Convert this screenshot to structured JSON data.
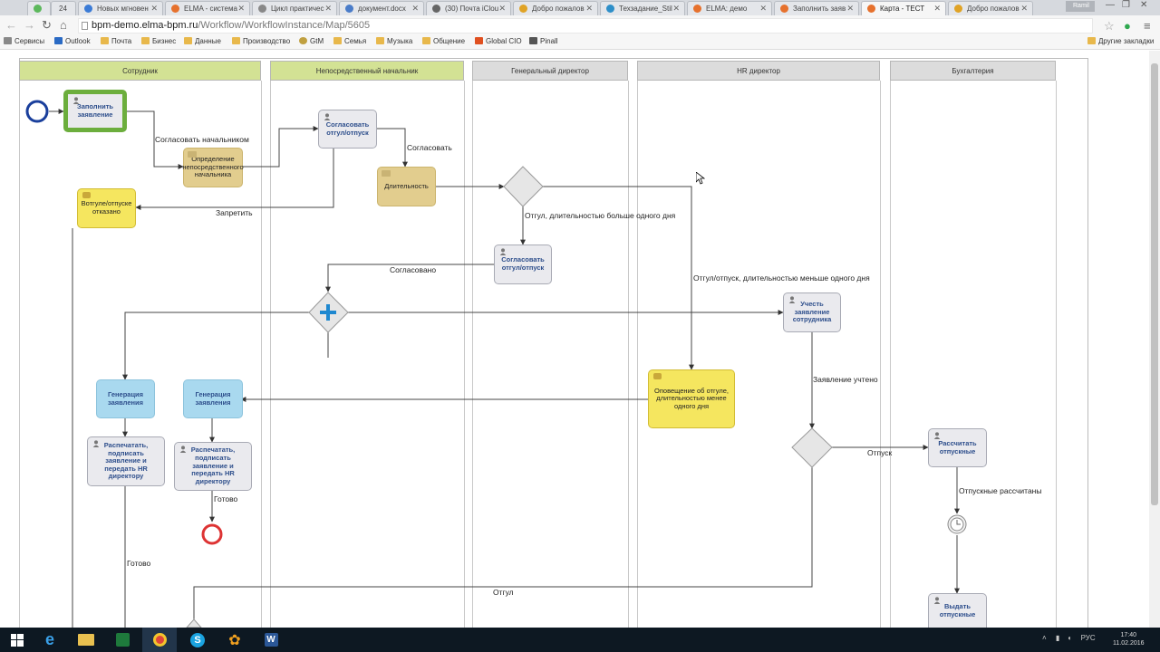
{
  "browser": {
    "tabs": [
      {
        "label": ""
      },
      {
        "label": "24"
      },
      {
        "label": "Новых мгновен"
      },
      {
        "label": "ELMA - система"
      },
      {
        "label": "Цикл практичес"
      },
      {
        "label": "документ.docx"
      },
      {
        "label": "(30) Почта iClou"
      },
      {
        "label": "Добро пожалов"
      },
      {
        "label": "Техзадание_Stil"
      },
      {
        "label": "ELMA: демо"
      },
      {
        "label": "Заполнить заяв"
      },
      {
        "label": "Карта - ТЕСТ"
      },
      {
        "label": "Добро пожалов"
      }
    ],
    "user": "Ramil",
    "url_host": "bpm-demo.elma-bpm.ru",
    "url_path": "/Workflow/WorkflowInstance/Map/5605",
    "bookmarks": [
      "Сервисы",
      "Outlook",
      "Почта",
      "Бизнес",
      "Данные",
      "Производство",
      "GtM",
      "Семья",
      "Музыка",
      "Общение",
      "Global CIO",
      "Pinall"
    ],
    "other_bookmarks": "Другие закладки"
  },
  "lanes": [
    "Сотрудник",
    "Непосредственный начальник",
    "Генеральный директор",
    "HR директор",
    "Бухгалтерия"
  ],
  "nodes": {
    "fill_request": "Заполнить заявление",
    "define_manager": "Определение непосредственного начальника",
    "approve_manager": "Согласовать отгул/отпуск",
    "duration": "Длительность",
    "rejected": "Вотгуле/отпуске отказано",
    "approve_ceo": "Согласовать отгул/отпуск",
    "account_hr": "Учесть заявление сотрудника",
    "notify_short": "Оповещение об отгуле, длительностью менее одного дня",
    "gen_req_1": "Генерация заявления",
    "gen_req_2": "Генерация заявления",
    "print_1": "Распечатать, подписать заявление и передать HR директору",
    "print_2": "Распечатать, подписать заявление и передать HR директору",
    "calc_vacation": "Рассчитать отпускные",
    "issue_vacation": "Выдать отпускные"
  },
  "edges": {
    "to_manager": "Согласовать начальником",
    "approve": "Согласовать",
    "reject": "Запретить",
    "long_leave": "Отгул, длительностью больше одного дня",
    "approved": "Согласовано",
    "short_leave": "Отгул/отпуск, длительностью меньше одного дня",
    "accounted": "Заявление учтено",
    "vacation": "Отпуск",
    "calculated": "Отпускные рассчитаны",
    "done_1": "Готово",
    "done_2": "Готово",
    "leave": "Отгул"
  },
  "taskbar": {
    "lang": "РУС",
    "time": "17:40",
    "date": "11.02.2016"
  }
}
